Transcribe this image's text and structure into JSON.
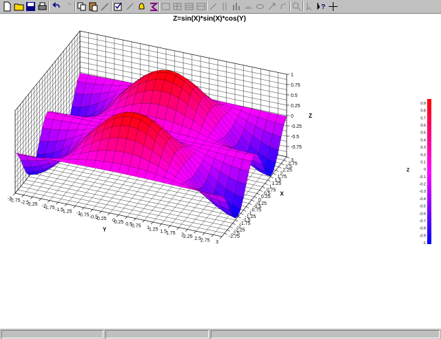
{
  "toolbar": {
    "buttons": [
      {
        "name": "new-file-icon"
      },
      {
        "name": "open-folder-icon"
      },
      {
        "name": "save-disk-icon"
      },
      {
        "name": "print-icon"
      },
      {
        "name": "undo-icon"
      },
      {
        "name": "redo-icon"
      },
      {
        "name": "copy-icon"
      },
      {
        "name": "paste-icon"
      },
      {
        "name": "pencil-icon"
      },
      {
        "name": "checkbox-edit-icon"
      },
      {
        "name": "check-pencil-icon"
      },
      {
        "name": "bell-icon"
      },
      {
        "name": "formula-icon"
      },
      {
        "name": "grid1-icon"
      },
      {
        "name": "grid2-icon"
      },
      {
        "name": "grid3-icon"
      },
      {
        "name": "grid4-icon"
      },
      {
        "name": "line-tool-icon"
      },
      {
        "name": "axis-tool-icon"
      },
      {
        "name": "hist-tool-icon"
      },
      {
        "name": "surface-tool-icon"
      },
      {
        "name": "contour-tool-icon"
      },
      {
        "name": "arrow-tool-icon"
      },
      {
        "name": "rotate-tool-icon"
      },
      {
        "name": "zoom-tool-icon"
      },
      {
        "name": "pointer-tool-icon"
      },
      {
        "name": "help-icon"
      },
      {
        "name": "crosshair-icon"
      }
    ]
  },
  "colors": {
    "positive": "#ff0000",
    "zero": "#ff00ff",
    "negative": "#0000ff",
    "grid": "#000000"
  },
  "chart_data": {
    "type": "surface",
    "title": "Z=sin(X)*sin(X)*cos(Y)",
    "xlabel": "X",
    "ylabel": "Y",
    "zlabel": "Z",
    "xlim": [
      -3,
      3
    ],
    "ylim": [
      -3,
      3
    ],
    "zlim": [
      -1,
      1
    ],
    "x_ticks": [
      "-2.75",
      "-2.5",
      "-2.25",
      "-2",
      "-1.75",
      "-1.5",
      "-1.25",
      "-1",
      "-0.75",
      "-0.5",
      "-0.25",
      "0",
      "0.25",
      "0.5",
      "0.75",
      "1",
      "1.25",
      "1.5",
      "1.75",
      "2",
      "2.25",
      "2.5",
      "2.75",
      "3"
    ],
    "y_ticks": [
      "3",
      "2.75",
      "2.5",
      "2.25",
      "2",
      "1.75",
      "1.5",
      "1.25",
      "1",
      "0.75",
      "0.5",
      "0.25",
      "0",
      "-0.25",
      "-0.5",
      "-0.75",
      "-1",
      "-1.25",
      "-1.5",
      "-1.75",
      "-2",
      "-2.25",
      "-2.5",
      "-2.75",
      "-3"
    ],
    "z_ticks": [
      "1",
      "0.75",
      "0.5",
      "0.25",
      "0",
      "-0.25",
      "-0.5",
      "-0.75"
    ],
    "colorbar_ticks": [
      "0.9",
      "0.8",
      "0.7",
      "0.6",
      "0.5",
      "0.4",
      "0.3",
      "0.2",
      "0.1",
      "0",
      "-0.1",
      "-0.2",
      "-0.3",
      "-0.4",
      "-0.5",
      "-0.6",
      "-0.7",
      "-0.8",
      "-0.9",
      "-1"
    ],
    "colorbar_label": "Z",
    "grid": true
  }
}
